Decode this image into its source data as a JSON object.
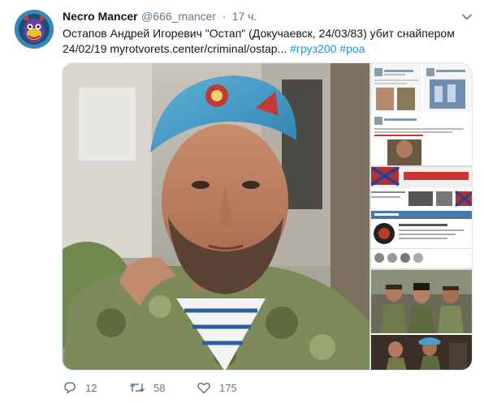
{
  "user": {
    "display_name": "Necro Mancer",
    "handle": "@666_mancer",
    "separator": "·",
    "time": "17 ч."
  },
  "tweet": {
    "text": "Остапов Андрей Игоревич \"Остап\" (Докучаевск, 24/03/83) убит снайпером 24/02/19",
    "link": "myrotvorets.center/criminal/ostap...",
    "hashtags": [
      "#груз200",
      "#роа"
    ]
  },
  "actions": {
    "reply_count": "12",
    "retweet_count": "58",
    "like_count": "175"
  },
  "icons": {
    "menu": "chevron-down-icon",
    "reply": "reply-icon",
    "retweet": "retweet-icon",
    "like": "heart-icon"
  },
  "colors": {
    "link_blue": "#1b95e0",
    "muted_gray": "#657786",
    "text": "#14171a"
  }
}
